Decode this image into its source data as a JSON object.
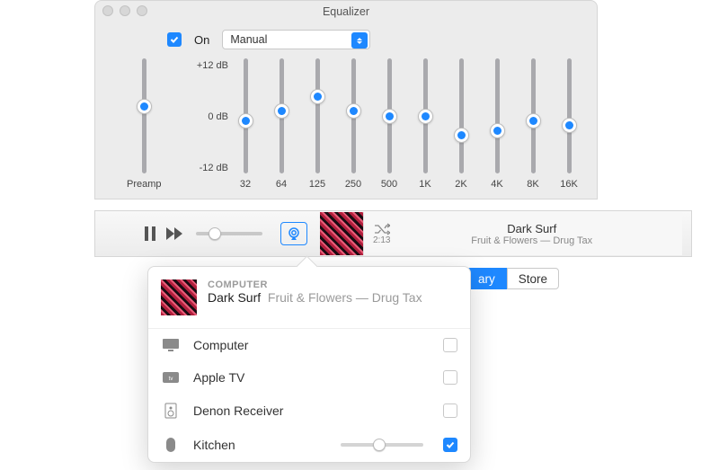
{
  "eq": {
    "title": "Equalizer",
    "on_label": "On",
    "on_checked": true,
    "preset": "Manual",
    "db_labels": {
      "top": "+12 dB",
      "mid": "0 dB",
      "bot": "-12 dB"
    },
    "preamp_label": "Preamp",
    "preamp_value": 2,
    "bands": [
      {
        "hz": "32",
        "db": -1
      },
      {
        "hz": "64",
        "db": 1
      },
      {
        "hz": "125",
        "db": 4
      },
      {
        "hz": "250",
        "db": 1
      },
      {
        "hz": "500",
        "db": 0
      },
      {
        "hz": "1K",
        "db": 0
      },
      {
        "hz": "2K",
        "db": -4
      },
      {
        "hz": "4K",
        "db": -3
      },
      {
        "hz": "8K",
        "db": -1
      },
      {
        "hz": "16K",
        "db": -2
      }
    ]
  },
  "player": {
    "elapsed": "2:13",
    "title": "Dark Surf",
    "artist_album": "Fruit & Flowers — Drug Tax",
    "volume_pct": 20
  },
  "tabs": {
    "library": "ary",
    "store": "Store"
  },
  "popover": {
    "source_label": "COMPUTER",
    "title": "Dark Surf",
    "artist_album": "Fruit & Flowers — Drug Tax",
    "devices": [
      {
        "name": "Computer",
        "checked": false,
        "has_volume": false,
        "icon": "display"
      },
      {
        "name": "Apple TV",
        "checked": false,
        "has_volume": false,
        "icon": "appletv"
      },
      {
        "name": "Denon Receiver",
        "checked": false,
        "has_volume": false,
        "icon": "speaker"
      },
      {
        "name": "Kitchen",
        "checked": true,
        "has_volume": true,
        "volume_pct": 40,
        "icon": "homepod"
      }
    ]
  },
  "colors": {
    "accent": "#1e88ff"
  }
}
